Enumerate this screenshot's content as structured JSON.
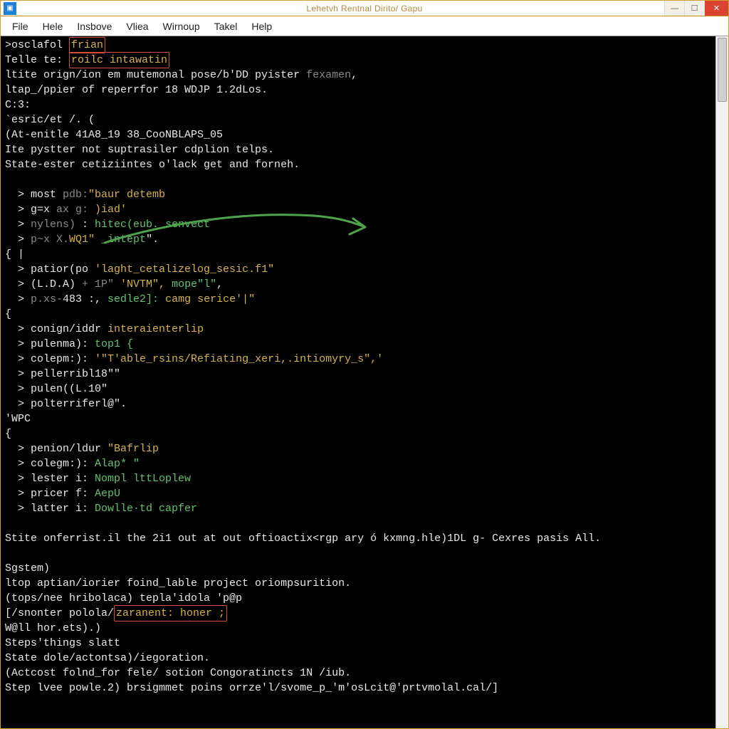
{
  "titlebar": {
    "title": "Lehetvh Rentnal Dirito/ Gapu"
  },
  "menu": {
    "items": [
      "File",
      "Hele",
      "Insbove",
      "Vliea",
      "Wirnoup",
      "Takel",
      "Help"
    ]
  },
  "term": {
    "l01a": ">osclafol ",
    "l01b": "frian",
    "l02a": "Telle te: ",
    "l02b": "roilc intawatin",
    "l03": "ltite orign/ion em mutemonal pose/b'DD pyister ",
    "l03b": "fexamen",
    "l03c": ",",
    "l04": "ltap_/ppier of reperrfor 18 WDJP 1.2dLos.",
    "l05": "C:3:",
    "l06": "`esric/et /. (",
    "l07": "(At-enitle 41A8_19 38_CooNBLAPS_05",
    "l08": "Ite pystter not suptrasiler cdplion telps.",
    "l09": "State-ester cetiziintes o'lack get and forneh.",
    "l10": "",
    "l11a": "  > most ",
    "l11b": "pdb:",
    "l11c": "\"baur detemb",
    "l12a": "  > g=x ",
    "l12b": "ax g:",
    "l12c": " )iad'",
    "l13a": "  > ",
    "l13b": "nylens) ",
    "l13c": ": ",
    "l13d": "hitec(eub._senvect",
    "l14a": "  > ",
    "l14b": "p~x X.",
    "l14c": "WQ1\" ",
    "l14d": "_intept",
    "l14e": "\".",
    "l15": "{ |",
    "l16a": "  > patior(po ",
    "l16b": "'laght_cetalizelog_sesic.f1\"",
    "l17a": "  > (L.D.A) ",
    "l17b": "+ 1P\"",
    "l17c": " 'NVTM\", ",
    "l17d": "mope\"l\"",
    "l17e": ",",
    "l18a": "  > ",
    "l18b": "p.xs-",
    "l18c": "483 :, ",
    "l18d": "sedle2]: ",
    "l18e": "camg serice'|\"",
    "l19": "{",
    "l20a": "  > conign/iddr ",
    "l20b": "interaienterlip",
    "l21a": "  > pulenma): ",
    "l21b": "top1 {",
    "l22a": "  > colepm:): ",
    "l22b": "'\"T'able_rsins/Refiating_xeri,.intiomyry_s\",'",
    "l23": "  > pellerribl18\"\"",
    "l24": "  > pulen((L.10\"",
    "l25": "  > polterriferl@\".",
    "l26": "'WPC",
    "l27": "{",
    "l28a": "  > penion/ldur ",
    "l28b": "\"Bafrlip",
    "l29a": "  > colegm:): ",
    "l29b": "Alap* \"",
    "l30a": "  > lester i: ",
    "l30b": "Nompl lttLoplew",
    "l31a": "  > pricer f: ",
    "l31b": "AepU",
    "l32a": "  > latter i: ",
    "l32b": "Dowlle·td capfer",
    "l33": "",
    "l34": "Stite onferrist.il the 2i1 out at out oftioactix<rgp ary ó kxmng.hle)1DL g- Cexres pasis All.",
    "l35": "",
    "l36": "Sgstem)",
    "l37": "ltop aptian/iorier foind_lable project oriompsurition.",
    "l38a": "(tops/nee hribolaca) tepla'idola 'p@p",
    "l39a": "[/snonter polola/",
    "l39b": "zaranent: honer ;",
    "l40": "W@ll hor.ets).)",
    "l41": "Steps'things slatt",
    "l42": "State dole/actontsa)/iegoration.",
    "l43": "(Actcost folnd_for fele/ sotion Congoratincts 1N /iub.",
    "l44a": "Step lvee powle.2) brsigmmet poins orrze'l/svome_p_'m'osLcit@'prtvmolal.cal/]"
  }
}
